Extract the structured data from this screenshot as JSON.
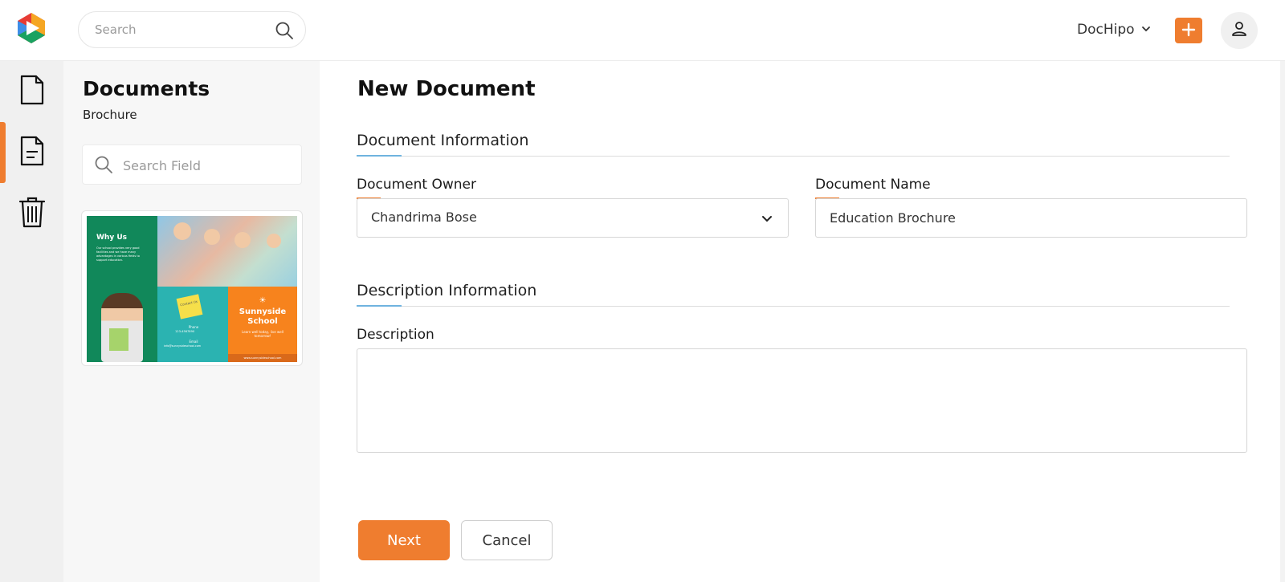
{
  "header": {
    "logo_icon": "play-logo-icon",
    "search_placeholder": "Search",
    "account_name": "DocHipo",
    "add_icon": "plus-icon",
    "user_icon": "user-icon"
  },
  "rail": {
    "items": [
      {
        "icon": "document-icon",
        "active": false
      },
      {
        "icon": "document-lines-icon",
        "active": true
      },
      {
        "icon": "trash-icon",
        "active": false
      }
    ]
  },
  "panel": {
    "title": "Documents",
    "subtitle": "Brochure",
    "search_placeholder": "Search Field",
    "thumbnail": {
      "why_us": "Why Us",
      "body": "Our school provides very good facilities and we have many advantages in various fields to support education.",
      "note": "Contact Us",
      "phone_label": "Phone",
      "phone": "123-4567890",
      "email_label": "Email",
      "email": "info@sunnysideschool.com",
      "school_line1": "Sunnyside",
      "school_line2": "School",
      "tagline": "Learn well today, live well tomorrow!",
      "website": "www.sunnysideschool.com"
    }
  },
  "form": {
    "page_title": "New Document",
    "section1_title": "Document Information",
    "owner_label": "Document Owner",
    "owner_value": "Chandrima Bose",
    "name_label": "Document Name",
    "name_value": "Education Brochure",
    "section2_title": "Description Information",
    "description_label": "Description",
    "description_value": "",
    "next_label": "Next",
    "cancel_label": "Cancel"
  },
  "colors": {
    "accent": "#ef7d2f",
    "section_accent": "#6fb3df",
    "rail_bg": "#f0f0f0",
    "panel_bg": "#f7f7f7"
  }
}
